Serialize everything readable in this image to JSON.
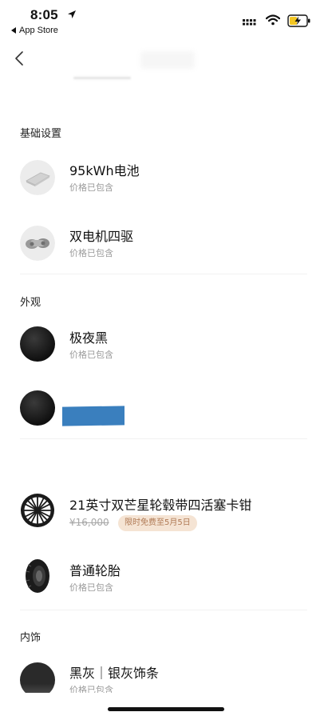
{
  "status_bar": {
    "time": "8:05",
    "back_app": "App Store"
  },
  "sections": {
    "basic": "基础设置",
    "exterior": "外观",
    "interior": "内饰"
  },
  "items": {
    "battery": {
      "name": "95kWh电池",
      "sub": "价格已包含"
    },
    "drive": {
      "name": "双电机四驱",
      "sub": "价格已包含"
    },
    "color": {
      "name": "极夜黑",
      "sub": "价格已包含"
    },
    "wheel": {
      "name": "21英寸双芒星轮毂带四活塞卡钳",
      "price": "¥16,000",
      "promo": "限时免费至5月5日"
    },
    "tire": {
      "name": "普通轮胎",
      "sub": "价格已包含"
    },
    "trim": {
      "name": "黑灰｜银灰饰条",
      "sub": "价格已包含"
    }
  },
  "colors": {
    "accent_badge_bg": "#f5e4d4",
    "accent_badge_text": "#b07a55",
    "redaction": "#3a7fbe"
  }
}
